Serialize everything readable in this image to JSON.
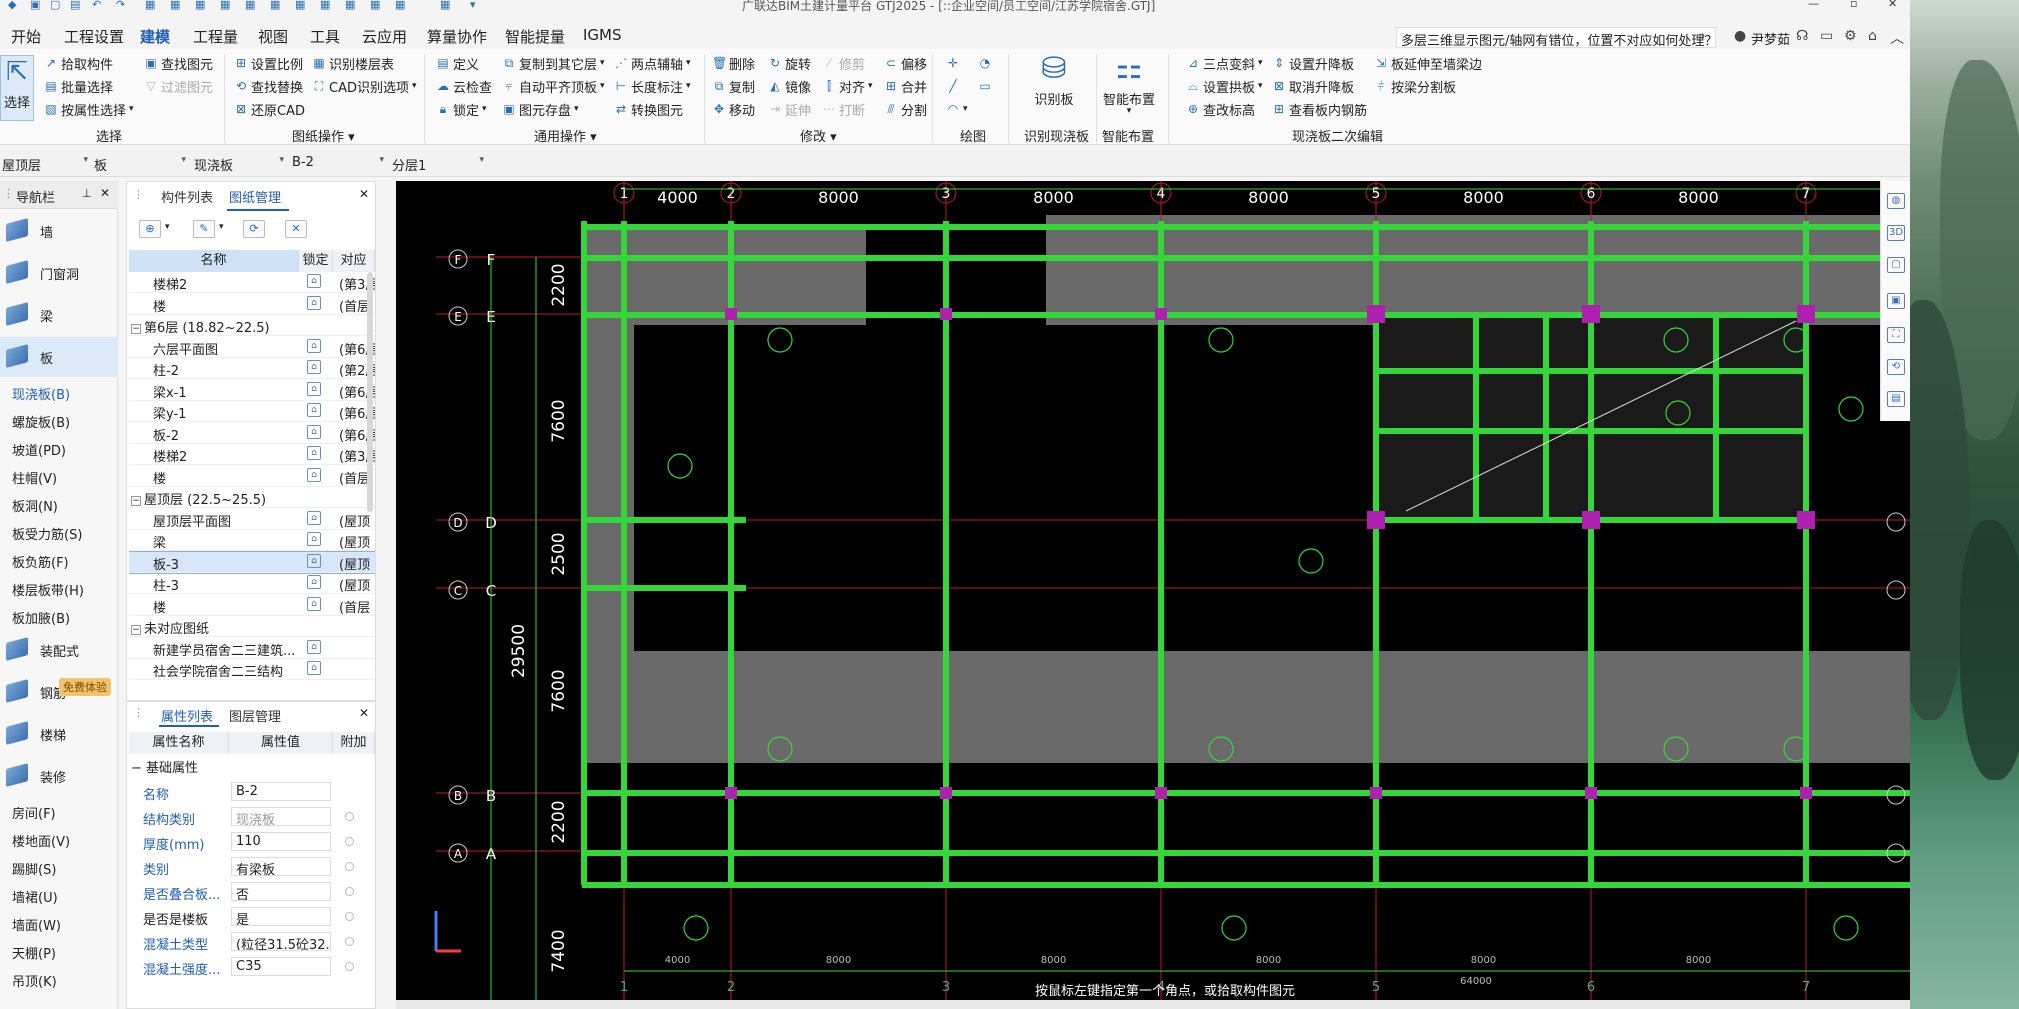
{
  "window": {
    "title": "广联达BIM土建计量平台 GTJ2025 - [::企业空间/员工空间/江苏学院宿舍.GTJ]"
  },
  "menu": {
    "items": [
      "开始",
      "工程设置",
      "建模",
      "工程量",
      "视图",
      "工具",
      "云应用",
      "算量协作",
      "智能提量",
      "IGMS"
    ],
    "active": "建模"
  },
  "help_search": {
    "value": "多层三维显示图元/轴网有错位，位置不对应如何处理？"
  },
  "user": {
    "name": "尹梦茹"
  },
  "ribbon": {
    "groups": [
      {
        "label": "选择",
        "items": [
          "选择",
          "拾取构件",
          "批量选择",
          "按属性选择",
          "查找图元",
          "过滤图元"
        ]
      },
      {
        "label": "图纸操作",
        "items": [
          "设置比例",
          "识别楼层表",
          "查找替换",
          "CAD识别选项",
          "还原CAD"
        ]
      },
      {
        "label": "通用操作",
        "items": [
          "定义",
          "复制到其它层",
          "两点辅轴",
          "云检查",
          "自动平齐顶板",
          "长度标注",
          "锁定",
          "图元存盘",
          "转换图元"
        ]
      },
      {
        "label": "修改",
        "items": [
          "删除",
          "旋转",
          "修剪",
          "偏移",
          "复制",
          "镜像",
          "对齐",
          "合并",
          "移动",
          "延伸",
          "打断",
          "分割"
        ]
      },
      {
        "label": "绘图",
        "items": []
      },
      {
        "label": "识别现浇板",
        "items": [
          "识别板"
        ]
      },
      {
        "label": "智能布置",
        "items": [
          "智能布置"
        ]
      },
      {
        "label": "现浇板二次编辑",
        "items": [
          "三点变斜",
          "设置升降板",
          "板延伸至墙梁边",
          "设置拱板",
          "取消升降板",
          "按梁分割板",
          "查改标高",
          "查看板内钢筋"
        ]
      }
    ]
  },
  "selectors": [
    "屋顶层",
    "板",
    "现浇板",
    "B-2",
    "分层1"
  ],
  "nav": {
    "title": "导航栏",
    "big_items": [
      "墙",
      "门窗洞",
      "梁",
      "板",
      "装配式",
      "钢筋",
      "楼梯",
      "装修"
    ],
    "active_big": "板",
    "sub_items": [
      "现浇板(B)",
      "螺旋板(B)",
      "坡道(PD)",
      "柱帽(V)",
      "板洞(N)",
      "板受力筋(S)",
      "板负筋(F)",
      "楼层板带(H)",
      "板加腋(B)"
    ],
    "active_sub": "现浇板(B)",
    "decor_items": [
      "房间(F)",
      "楼地面(V)",
      "踢脚(S)",
      "墙裙(U)",
      "墙面(W)",
      "天棚(P)",
      "吊顶(K)"
    ],
    "badge": "免费体验"
  },
  "drawing_panel": {
    "tabs": [
      "构件列表",
      "图纸管理"
    ],
    "active_tab": "图纸管理",
    "headers": [
      "名称",
      "锁定",
      "对应"
    ],
    "rows": [
      {
        "type": "item",
        "name": "楼梯2",
        "map": "(第3层"
      },
      {
        "type": "item",
        "name": "楼",
        "map": "(首层"
      },
      {
        "type": "group",
        "name": "第6层 (18.82~22.5)"
      },
      {
        "type": "item",
        "name": "六层平面图",
        "map": "(第6层"
      },
      {
        "type": "item",
        "name": "柱-2",
        "map": "(第2层"
      },
      {
        "type": "item",
        "name": "梁x-1",
        "map": "(第6层"
      },
      {
        "type": "item",
        "name": "梁y-1",
        "map": "(第6层"
      },
      {
        "type": "item",
        "name": "板-2",
        "map": "(第6层"
      },
      {
        "type": "item",
        "name": "楼梯2",
        "map": "(第3层"
      },
      {
        "type": "item",
        "name": "楼",
        "map": "(首层"
      },
      {
        "type": "group",
        "name": "屋顶层 (22.5~25.5)"
      },
      {
        "type": "item",
        "name": "屋顶层平面图",
        "map": "(屋顶"
      },
      {
        "type": "item",
        "name": "梁",
        "map": "(屋顶"
      },
      {
        "type": "item",
        "name": "板-3",
        "map": "(屋顶",
        "selected": true
      },
      {
        "type": "item",
        "name": "柱-3",
        "map": "(屋顶"
      },
      {
        "type": "item",
        "name": "楼",
        "map": "(首层"
      },
      {
        "type": "group",
        "name": "未对应图纸"
      },
      {
        "type": "item",
        "name": "新建学员宿舍二三建筑...",
        "map": ""
      },
      {
        "type": "item",
        "name": "社会学院宿舍二三结构",
        "map": ""
      }
    ]
  },
  "property_panel": {
    "tabs": [
      "属性列表",
      "图层管理"
    ],
    "active_tab": "属性列表",
    "headers": [
      "属性名称",
      "属性值",
      "附加"
    ],
    "section": "基础属性",
    "rows": [
      {
        "name": "名称",
        "value": "B-2",
        "blue": true,
        "grey": false
      },
      {
        "name": "结构类别",
        "value": "现浇板",
        "blue": true,
        "grey": true
      },
      {
        "name": "厚度(mm)",
        "value": "110",
        "blue": true,
        "grey": false
      },
      {
        "name": "类别",
        "value": "有梁板",
        "blue": true,
        "grey": false
      },
      {
        "name": "是否叠合板...",
        "value": "否",
        "blue": true,
        "grey": false
      },
      {
        "name": "是否是楼板",
        "value": "是",
        "blue": false,
        "grey": false
      },
      {
        "name": "混凝土类型",
        "value": "(粒径31.5砼32...",
        "blue": true,
        "grey": false
      },
      {
        "name": "混凝土强度...",
        "value": "C35",
        "blue": true,
        "grey": false
      }
    ]
  },
  "canvas": {
    "top_axes": [
      "1",
      "2",
      "3",
      "4",
      "5",
      "6",
      "7"
    ],
    "top_dims": [
      "4000",
      "8000",
      "8000",
      "8000",
      "8000",
      "8000"
    ],
    "bottom_dims": [
      "4000",
      "8000",
      "8000",
      "8000",
      "8000",
      "8000",
      "64000"
    ],
    "left_axes": [
      "F",
      "E",
      "D",
      "C",
      "B",
      "A"
    ],
    "left_dims": [
      "2200",
      "7600",
      "2500",
      "7600",
      "2200",
      "29500",
      "7400"
    ],
    "hint": "按鼠标左键指定第一个角点，或拾取构件图元",
    "colors": {
      "beam": "#35d63a",
      "slab": "#6a6a6a",
      "axis": "#c4182a",
      "dim": "#35d63a",
      "column": "#b020b0"
    }
  }
}
